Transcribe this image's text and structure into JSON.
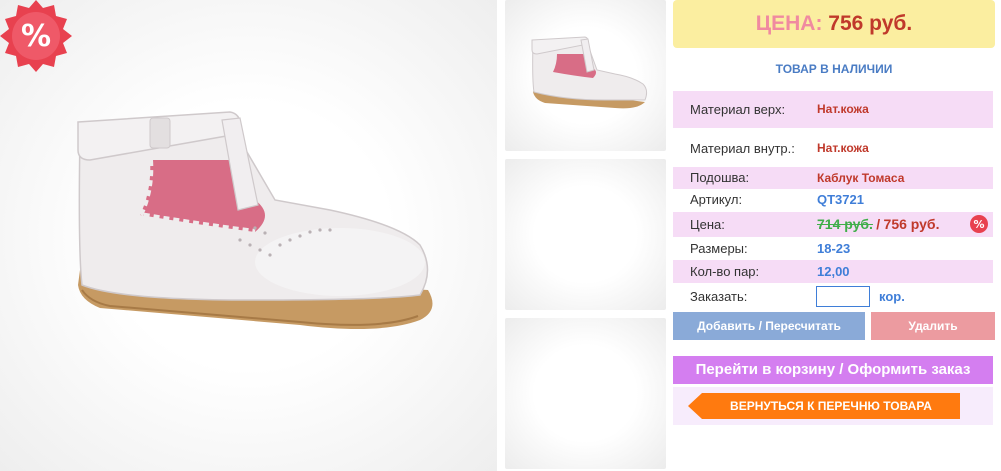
{
  "price": {
    "label": "ЦЕНА:",
    "value": "756 руб."
  },
  "stock_status": "ТОВАР В НАЛИЧИИ",
  "specs": [
    {
      "key": "Материал верх:",
      "value": "Нат.кожа"
    },
    {
      "key": "Материал внутр.:",
      "value": "Нат.кожа"
    },
    {
      "key": "Подошва:",
      "value": "Каблук Томаса"
    },
    {
      "key": "Артикул:",
      "value": "QT3721"
    },
    {
      "key": "Цена:",
      "old_value": "714 руб.",
      "separator": "/",
      "new_value": "756 руб."
    },
    {
      "key": "Размеры:",
      "value": "18-23"
    },
    {
      "key": "Кол-во пар:",
      "value": "12,00"
    },
    {
      "key": "Заказать:",
      "input_value": "",
      "unit": "кор."
    }
  ],
  "buttons": {
    "add": "Добавить / Пересчитать",
    "delete": "Удалить",
    "cart": "Перейти в корзину / Оформить заказ",
    "back": "ВЕРНУТЬСЯ К ПЕРЕЧНЮ ТОВАРА"
  },
  "badge": {
    "symbol": "%",
    "color": "#e8414f"
  },
  "colors": {
    "price_bg": "#fbeea0",
    "row_pink": "#f6dcf6",
    "accent_blue": "#3f7ed8",
    "accent_red": "#c0392b",
    "button_orange": "#ff7a0f",
    "button_violet": "#d47ef0"
  }
}
